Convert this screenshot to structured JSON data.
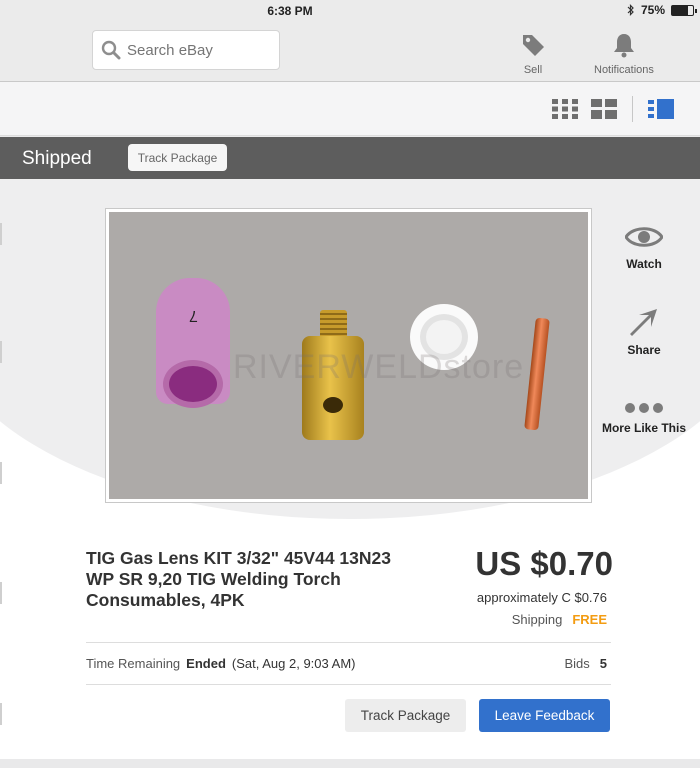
{
  "status_bar": {
    "time": "6:38 PM",
    "battery": "75%",
    "battery_level": 0.75
  },
  "nav": {
    "search_placeholder": "Search eBay",
    "sell_label": "Sell",
    "notifications_label": "Notifications"
  },
  "view_modes": [
    "grid-small-icon",
    "grid-large-icon",
    "list-icon"
  ],
  "banner": {
    "title": "Shipped",
    "track_button": "Track Package"
  },
  "image": {
    "watermark": "RIVERWELDstore",
    "cup_number": "7"
  },
  "side_actions": {
    "watch": "Watch",
    "share": "Share",
    "more": "More Like This"
  },
  "item": {
    "title": "TIG Gas Lens KIT 3/32\" 45V44 13N23 WP SR 9,20 TIG Welding Torch Consumables, 4PK",
    "price": "US $0.70",
    "approx": "approximately C $0.76",
    "shipping_label": "Shipping",
    "shipping_value": "FREE",
    "time_label": "Time Remaining",
    "time_status": "Ended",
    "time_date": "(Sat, Aug 2, 9:03 AM)",
    "bids_label": "Bids",
    "bids_value": "5"
  },
  "actions": {
    "track": "Track Package",
    "feedback": "Leave Feedback"
  },
  "colors": {
    "accent": "#3271cc",
    "free": "#f39c12",
    "banner": "#5d5d5d",
    "active_view": "#3271cc"
  }
}
